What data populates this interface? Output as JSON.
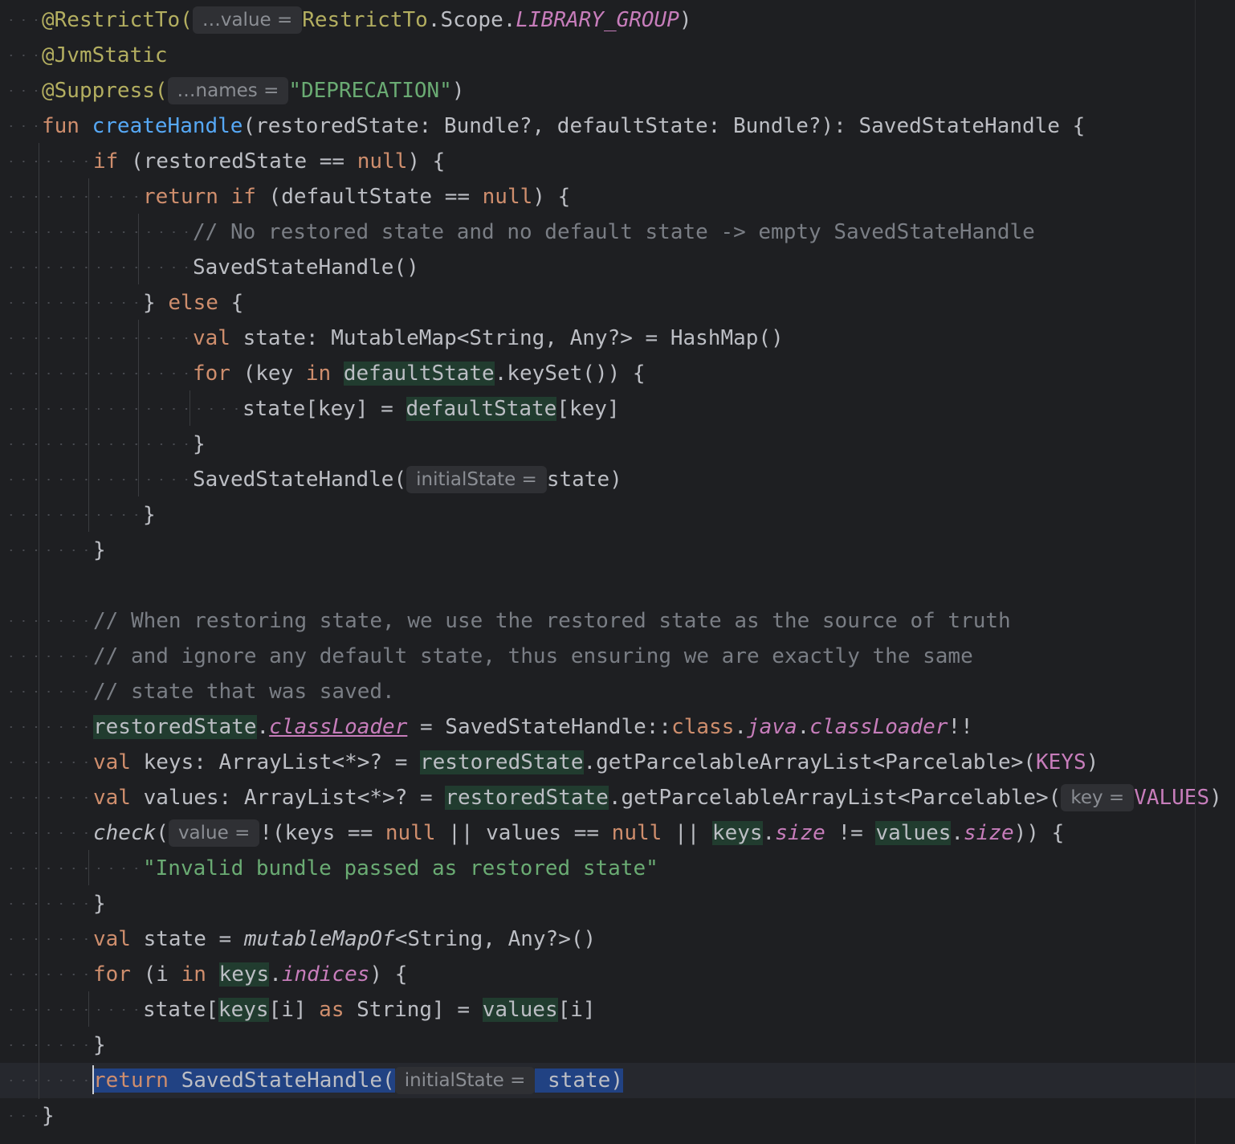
{
  "editor": {
    "lines": [
      {
        "indent": 1,
        "tokens": [
          {
            "t": "@RestrictTo(",
            "c": "ann"
          },
          {
            "t": "…value =",
            "c": "hint"
          },
          {
            "t": "RestrictTo",
            "c": "ann"
          },
          {
            "t": ".Scope.",
            "c": ""
          },
          {
            "t": "LIBRARY_GROUP",
            "c": "const"
          },
          {
            "t": ")",
            "c": ""
          }
        ]
      },
      {
        "indent": 1,
        "tokens": [
          {
            "t": "@JvmStatic",
            "c": "ann"
          }
        ]
      },
      {
        "indent": 1,
        "tokens": [
          {
            "t": "@Suppress(",
            "c": "ann"
          },
          {
            "t": "…names =",
            "c": "hint"
          },
          {
            "t": "\"DEPRECATION\"",
            "c": "str"
          },
          {
            "t": ")",
            "c": ""
          }
        ]
      },
      {
        "indent": 1,
        "tokens": [
          {
            "t": "fun ",
            "c": "kw"
          },
          {
            "t": "createHandle",
            "c": "fn"
          },
          {
            "t": "(restoredState: Bundle?, defaultState: Bundle?): SavedStateHandle {",
            "c": ""
          }
        ]
      },
      {
        "indent": 2,
        "tokens": [
          {
            "t": "if ",
            "c": "kw"
          },
          {
            "t": "(restoredState == ",
            "c": ""
          },
          {
            "t": "null",
            "c": "kw"
          },
          {
            "t": ") {",
            "c": ""
          }
        ]
      },
      {
        "indent": 3,
        "tokens": [
          {
            "t": "return if ",
            "c": "kw"
          },
          {
            "t": "(defaultState == ",
            "c": ""
          },
          {
            "t": "null",
            "c": "kw"
          },
          {
            "t": ") {",
            "c": ""
          }
        ]
      },
      {
        "indent": 4,
        "tokens": [
          {
            "t": "// No restored state and no default state -> empty SavedStateHandle",
            "c": "cmt"
          }
        ]
      },
      {
        "indent": 4,
        "tokens": [
          {
            "t": "SavedStateHandle()",
            "c": ""
          }
        ]
      },
      {
        "indent": 3,
        "tokens": [
          {
            "t": "} ",
            "c": ""
          },
          {
            "t": "else",
            "c": "kw"
          },
          {
            "t": " {",
            "c": ""
          }
        ]
      },
      {
        "indent": 4,
        "tokens": [
          {
            "t": "val ",
            "c": "kw"
          },
          {
            "t": "state: MutableMap<String, Any?> = HashMap()",
            "c": ""
          }
        ]
      },
      {
        "indent": 4,
        "tokens": [
          {
            "t": "for ",
            "c": "kw"
          },
          {
            "t": "(key ",
            "c": ""
          },
          {
            "t": "in ",
            "c": "kw"
          },
          {
            "t": "defaultState",
            "c": "mark"
          },
          {
            "t": ".keySet()) {",
            "c": ""
          }
        ]
      },
      {
        "indent": 5,
        "tokens": [
          {
            "t": "state[key] = ",
            "c": ""
          },
          {
            "t": "defaultState",
            "c": "mark"
          },
          {
            "t": "[key]",
            "c": ""
          }
        ]
      },
      {
        "indent": 4,
        "tokens": [
          {
            "t": "}",
            "c": ""
          }
        ]
      },
      {
        "indent": 4,
        "tokens": [
          {
            "t": "SavedStateHandle(",
            "c": ""
          },
          {
            "t": "initialState =",
            "c": "hint"
          },
          {
            "t": "state)",
            "c": ""
          }
        ]
      },
      {
        "indent": 3,
        "tokens": [
          {
            "t": "}",
            "c": ""
          }
        ]
      },
      {
        "indent": 2,
        "tokens": [
          {
            "t": "}",
            "c": ""
          }
        ]
      },
      {
        "indent": 0,
        "tokens": []
      },
      {
        "indent": 2,
        "tokens": [
          {
            "t": "// When restoring state, we use the restored state as the source of truth",
            "c": "cmt"
          }
        ]
      },
      {
        "indent": 2,
        "tokens": [
          {
            "t": "// and ignore any default state, thus ensuring we are exactly the same",
            "c": "cmt"
          }
        ]
      },
      {
        "indent": 2,
        "tokens": [
          {
            "t": "// state that was saved.",
            "c": "cmt"
          }
        ]
      },
      {
        "indent": 2,
        "tokens": [
          {
            "t": "restoredState",
            "c": "mark"
          },
          {
            "t": ".",
            "c": ""
          },
          {
            "t": "classLoader",
            "c": "prop ital ul"
          },
          {
            "t": " = SavedStateHandle::",
            "c": ""
          },
          {
            "t": "class",
            "c": "kw"
          },
          {
            "t": ".",
            "c": ""
          },
          {
            "t": "java",
            "c": "prop ital"
          },
          {
            "t": ".",
            "c": ""
          },
          {
            "t": "classLoader",
            "c": "prop ital"
          },
          {
            "t": "!!",
            "c": ""
          }
        ]
      },
      {
        "indent": 2,
        "tokens": [
          {
            "t": "val ",
            "c": "kw"
          },
          {
            "t": "keys: ArrayList<*>? = ",
            "c": ""
          },
          {
            "t": "restoredState",
            "c": "mark"
          },
          {
            "t": ".getParcelableArrayList<Parcelable>(",
            "c": ""
          },
          {
            "t": "KEYS",
            "c": "prop"
          },
          {
            "t": ")",
            "c": ""
          }
        ]
      },
      {
        "indent": 2,
        "tokens": [
          {
            "t": "val ",
            "c": "kw"
          },
          {
            "t": "values: ArrayList<*>? = ",
            "c": ""
          },
          {
            "t": "restoredState",
            "c": "mark"
          },
          {
            "t": ".getParcelableArrayList<Parcelable>(",
            "c": ""
          },
          {
            "t": "key =",
            "c": "hint"
          },
          {
            "t": "VALUES",
            "c": "prop"
          },
          {
            "t": ")",
            "c": ""
          }
        ]
      },
      {
        "indent": 2,
        "tokens": [
          {
            "t": "check",
            "c": "ital"
          },
          {
            "t": "(",
            "c": ""
          },
          {
            "t": "value =",
            "c": "hint"
          },
          {
            "t": "!(keys == ",
            "c": ""
          },
          {
            "t": "null",
            "c": "kw"
          },
          {
            "t": " || values == ",
            "c": ""
          },
          {
            "t": "null",
            "c": "kw"
          },
          {
            "t": " || ",
            "c": ""
          },
          {
            "t": "keys",
            "c": "mark"
          },
          {
            "t": ".",
            "c": ""
          },
          {
            "t": "size",
            "c": "prop ital"
          },
          {
            "t": " != ",
            "c": ""
          },
          {
            "t": "values",
            "c": "mark"
          },
          {
            "t": ".",
            "c": ""
          },
          {
            "t": "size",
            "c": "prop ital"
          },
          {
            "t": ")) {",
            "c": ""
          }
        ]
      },
      {
        "indent": 3,
        "tokens": [
          {
            "t": "\"Invalid bundle passed as restored state\"",
            "c": "str"
          }
        ]
      },
      {
        "indent": 2,
        "tokens": [
          {
            "t": "}",
            "c": ""
          }
        ]
      },
      {
        "indent": 2,
        "tokens": [
          {
            "t": "val ",
            "c": "kw"
          },
          {
            "t": "state = ",
            "c": ""
          },
          {
            "t": "mutableMapOf",
            "c": "ital"
          },
          {
            "t": "<String, Any?>()",
            "c": ""
          }
        ]
      },
      {
        "indent": 2,
        "tokens": [
          {
            "t": "for ",
            "c": "kw"
          },
          {
            "t": "(i ",
            "c": ""
          },
          {
            "t": "in ",
            "c": "kw"
          },
          {
            "t": "keys",
            "c": "mark"
          },
          {
            "t": ".",
            "c": ""
          },
          {
            "t": "indices",
            "c": "prop ital"
          },
          {
            "t": ") {",
            "c": ""
          }
        ]
      },
      {
        "indent": 3,
        "tokens": [
          {
            "t": "state[",
            "c": ""
          },
          {
            "t": "keys",
            "c": "mark"
          },
          {
            "t": "[i] ",
            "c": ""
          },
          {
            "t": "as ",
            "c": "kw"
          },
          {
            "t": "String] = ",
            "c": ""
          },
          {
            "t": "values",
            "c": "mark"
          },
          {
            "t": "[i]",
            "c": ""
          }
        ]
      },
      {
        "indent": 2,
        "tokens": [
          {
            "t": "}",
            "c": ""
          }
        ]
      },
      {
        "indent": 2,
        "current": true,
        "tokens": [
          {
            "t": "return ",
            "c": "kw sel"
          },
          {
            "t": "SavedStateHandle(",
            "c": "sel"
          },
          {
            "t": "initialState =",
            "c": "hint"
          },
          {
            "t": " state)",
            "c": "sel"
          }
        ]
      },
      {
        "indent": 1,
        "tokens": [
          {
            "t": "}",
            "c": ""
          }
        ]
      }
    ]
  }
}
